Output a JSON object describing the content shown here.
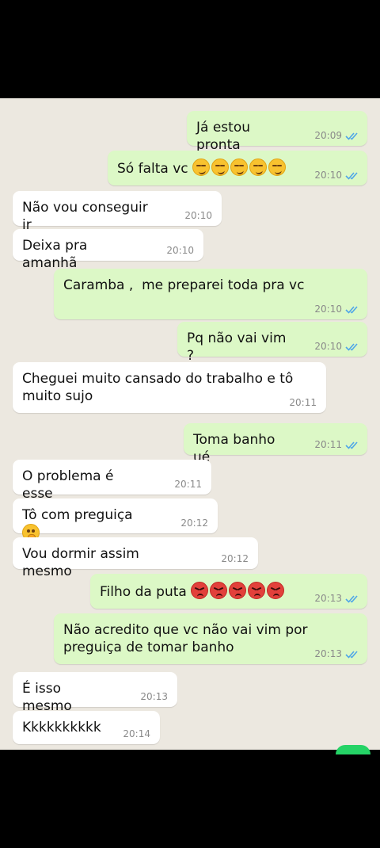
{
  "messages": [
    {
      "side": "out",
      "text": "Já estou pronta",
      "emojis": [],
      "time": "20:09",
      "read": true
    },
    {
      "side": "out",
      "text": "Só falta vc ",
      "emojis": [
        "smirk",
        "smirk",
        "smirk",
        "smirk",
        "smirk"
      ],
      "time": "20:10",
      "read": true
    },
    {
      "side": "in",
      "text": "Não vou conseguir ir",
      "emojis": [],
      "time": "20:10"
    },
    {
      "side": "in",
      "text": "Deixa pra amanhã",
      "emojis": [],
      "time": "20:10"
    },
    {
      "side": "out",
      "text": "Caramba ,  me preparei toda pra vc",
      "emojis": [],
      "time": "20:10",
      "read": true
    },
    {
      "side": "out",
      "text": "Pq não vai vim ?",
      "emojis": [],
      "time": "20:10",
      "read": true
    },
    {
      "side": "in",
      "text": "Cheguei muito cansado do trabalho e tô muito sujo",
      "emojis": [],
      "time": "20:11"
    },
    {
      "side": "out",
      "text": "Toma banho ué",
      "emojis": [],
      "time": "20:11",
      "read": true
    },
    {
      "side": "in",
      "text": "O problema é esse",
      "emojis": [],
      "time": "20:11"
    },
    {
      "side": "in",
      "text": "Tô com preguiça ",
      "emojis": [
        "hush"
      ],
      "time": "20:12"
    },
    {
      "side": "in",
      "text": "Vou dormir assim mesmo",
      "emojis": [],
      "time": "20:12"
    },
    {
      "side": "out",
      "text": "Filho da puta ",
      "emojis": [
        "angry",
        "angry",
        "angry",
        "angry",
        "angry"
      ],
      "time": "20:13",
      "read": true
    },
    {
      "side": "out",
      "text": "Não acredito que vc não vai vim por preguiça de tomar banho",
      "emojis": [],
      "time": "20:13",
      "read": true
    },
    {
      "side": "in",
      "text": "É isso mesmo",
      "emojis": [],
      "time": "20:13"
    },
    {
      "side": "in",
      "text": "Kkkkkkkkkk",
      "emojis": [],
      "time": "20:14"
    }
  ],
  "colors": {
    "outgoing": "#dcf8c6",
    "incoming": "#ffffff",
    "read_ticks": "#4fa6e8",
    "background": "#ece8e0"
  }
}
